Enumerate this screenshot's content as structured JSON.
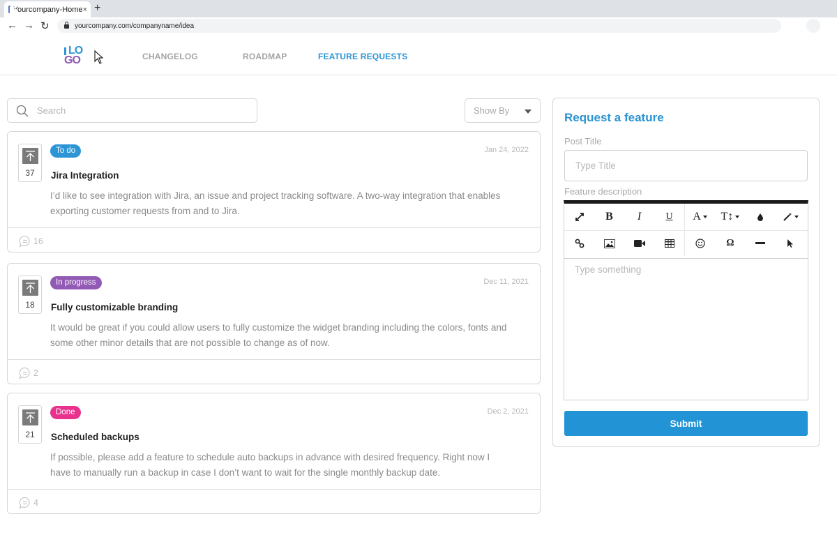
{
  "browser": {
    "tab_title": "Yourcompany-Home",
    "tab_close": "×",
    "new_tab": "+",
    "url": "yourcompany.com/companyname/idea"
  },
  "header": {
    "logo_top": "LO",
    "logo_bottom": "GO",
    "nav": [
      {
        "label": "CHANGELOG",
        "active": false
      },
      {
        "label": "ROADMAP",
        "active": false
      },
      {
        "label": "FEATURE REQUESTS",
        "active": true
      }
    ]
  },
  "toolbar": {
    "search_placeholder": "Search",
    "showby_label": "Show By"
  },
  "colors": {
    "accent": "#2293d5",
    "todo": "#2b95d6",
    "in_progress": "#9259b5",
    "done": "#e9318e"
  },
  "requests": [
    {
      "votes": "37",
      "status": "To do",
      "status_color": "#2b95d6",
      "date": "Jan 24, 2022",
      "title": "Jira Integration",
      "description": "I’d like to see integration with Jira, an issue and project tracking software. A two-way integration that enables exporting customer requests from and to Jira.",
      "comments": "16"
    },
    {
      "votes": "18",
      "status": "In progress",
      "status_color": "#9259b5",
      "date": "Dec 11, 2021",
      "title": "Fully customizable branding",
      "description": "It would be great if you could allow users to fully customize the widget branding including the colors, fonts and some other minor details that are not possible to change as of now.",
      "comments": "2"
    },
    {
      "votes": "21",
      "status": "Done",
      "status_color": "#e9318e",
      "date": "Dec 2, 2021",
      "title": "Scheduled backups",
      "description": "If possible, please add a feature to schedule auto backups in advance with desired frequency. Right now I have to manually run a backup in case I don’t want to wait for the single monthly backup date.",
      "comments": "4"
    }
  ],
  "request_form": {
    "heading": "Request a feature",
    "post_title_label": "Post Title",
    "post_title_placeholder": "Type Title",
    "description_label": "Feature description",
    "description_placeholder": "Type something",
    "editor_toolbar": {
      "row1": [
        "fullscreen-icon",
        "bold-icon",
        "italic-icon",
        "underline-icon",
        "font-color-icon",
        "font-size-icon",
        "color-drop-icon",
        "magic-wand-icon"
      ],
      "row2": [
        "link-icon",
        "image-icon",
        "video-icon",
        "table-icon",
        "emoji-icon",
        "special-char-icon",
        "horizontal-rule-icon",
        "select-cursor-icon"
      ],
      "bold": "B",
      "italic": "I",
      "underline": "U",
      "font": "A",
      "size": "T↕",
      "omega": "Ω"
    },
    "submit_label": "Submit"
  }
}
